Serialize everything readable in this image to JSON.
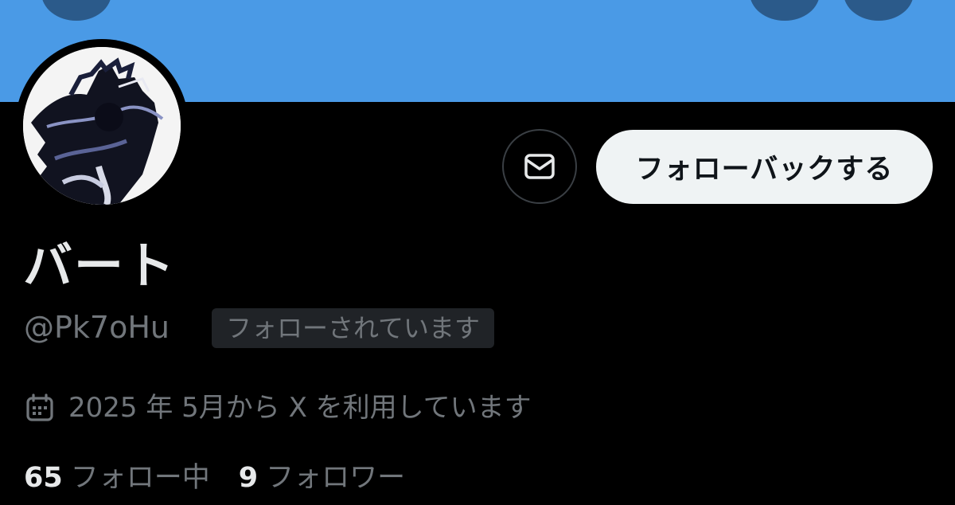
{
  "header": {
    "banner_color": "#4a9ae6",
    "icons": [
      "back-icon",
      "search-icon",
      "more-icon"
    ]
  },
  "profile": {
    "display_name": "バート",
    "handle": "@Pk7oHu",
    "follows_you_badge": "フォローされています",
    "joined_text": "2025 年 5月から X を利用しています",
    "avatar_icon": "avatar-image"
  },
  "actions": {
    "message_icon": "envelope-icon",
    "follow_back_label": "フォローバックする"
  },
  "stats": {
    "following_count": "65",
    "following_label": "フォロー中",
    "followers_count": "9",
    "followers_label": "フォロワー"
  },
  "colors": {
    "background": "#000000",
    "primary_text": "#e7e9ea",
    "secondary_text": "#71767b",
    "button_bg": "#eff3f4"
  }
}
